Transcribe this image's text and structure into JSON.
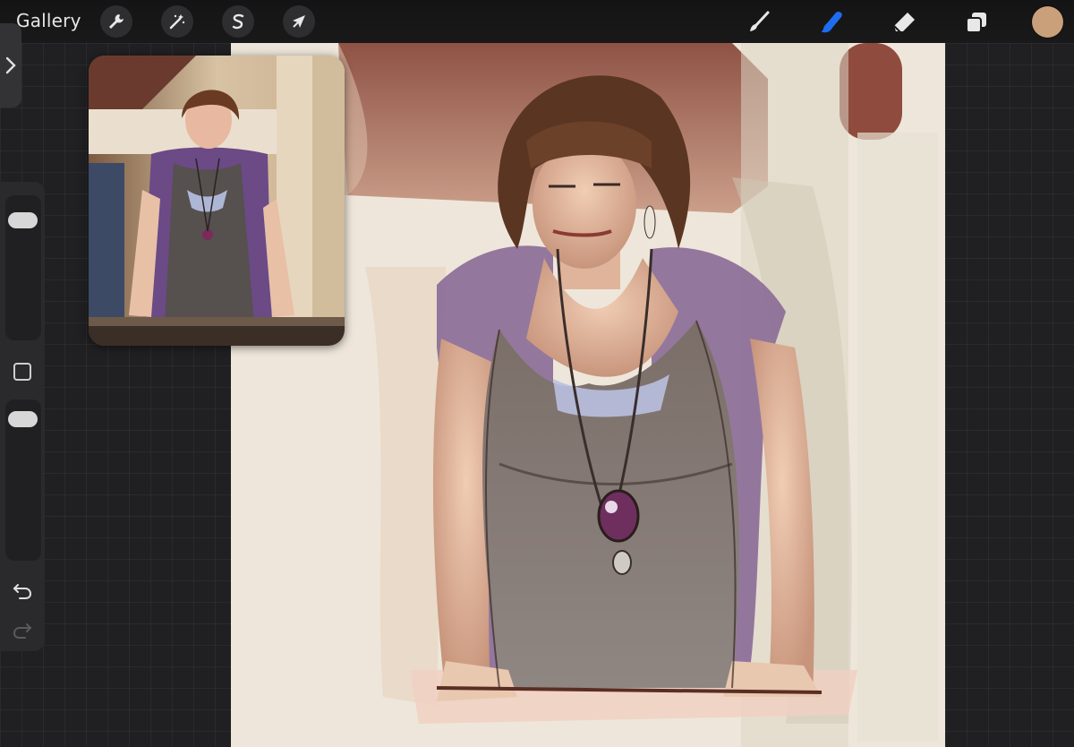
{
  "topbar": {
    "gallery_label": "Gallery",
    "left_tools": [
      {
        "name": "actions",
        "icon": "wrench-icon"
      },
      {
        "name": "adjustments",
        "icon": "magic-wand-icon"
      },
      {
        "name": "selection",
        "icon": "selection-s-icon"
      },
      {
        "name": "transform",
        "icon": "arrow-cursor-icon"
      }
    ],
    "right_tools": [
      {
        "name": "brush",
        "icon": "brush-icon",
        "active": false
      },
      {
        "name": "smudge",
        "icon": "smudge-finger-icon",
        "active": true
      },
      {
        "name": "eraser",
        "icon": "eraser-icon",
        "active": false
      },
      {
        "name": "layers",
        "icon": "layers-icon",
        "active": false
      }
    ],
    "active_color": "#c9a07a",
    "active_tool_color": "#1e6cf0"
  },
  "sidebar": {
    "brush_size_slider": "brush-size",
    "opacity_slider": "brush-opacity",
    "modify_button": "square-icon",
    "undo": "undo-icon",
    "redo": "redo-icon"
  },
  "reference_window": {
    "kind": "reference-photo"
  },
  "canvas": {
    "kind": "digital-painting",
    "palette": {
      "background": "#efe6da",
      "wall": "#8a4b3d",
      "hair": "#5a3522",
      "dress": "#6d625e",
      "cardigan": "#8a6a96",
      "skin": "#e2b79c",
      "pendant": "#6e2f5e"
    }
  }
}
